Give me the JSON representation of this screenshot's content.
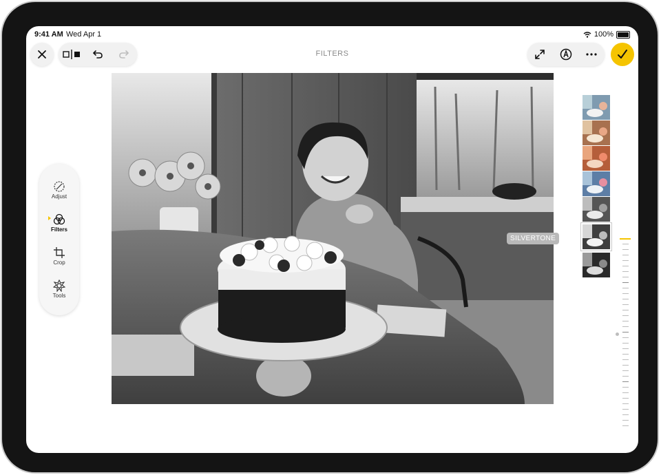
{
  "status_bar": {
    "time": "9:41 AM",
    "date": "Wed Apr 1",
    "battery": "100%"
  },
  "toolbar": {
    "title": "FILTERS",
    "close_icon": "close-icon",
    "compare_icon": "compare-icon",
    "undo_icon": "undo-icon",
    "redo_icon": "redo-icon",
    "expand_icon": "expand-icon",
    "markup_icon": "markup-icon",
    "more_icon": "more-icon",
    "done_icon": "checkmark-icon",
    "accent_color": "#f5c400"
  },
  "sidebar": {
    "items": [
      {
        "label": "Adjust",
        "icon": "adjust-icon"
      },
      {
        "label": "Filters",
        "icon": "filters-icon",
        "active": true
      },
      {
        "label": "Crop",
        "icon": "crop-icon"
      },
      {
        "label": "Tools",
        "icon": "tools-icon"
      }
    ]
  },
  "filters": {
    "selected_label": "SILVERTONE",
    "selected_index": 5,
    "count": 7
  }
}
